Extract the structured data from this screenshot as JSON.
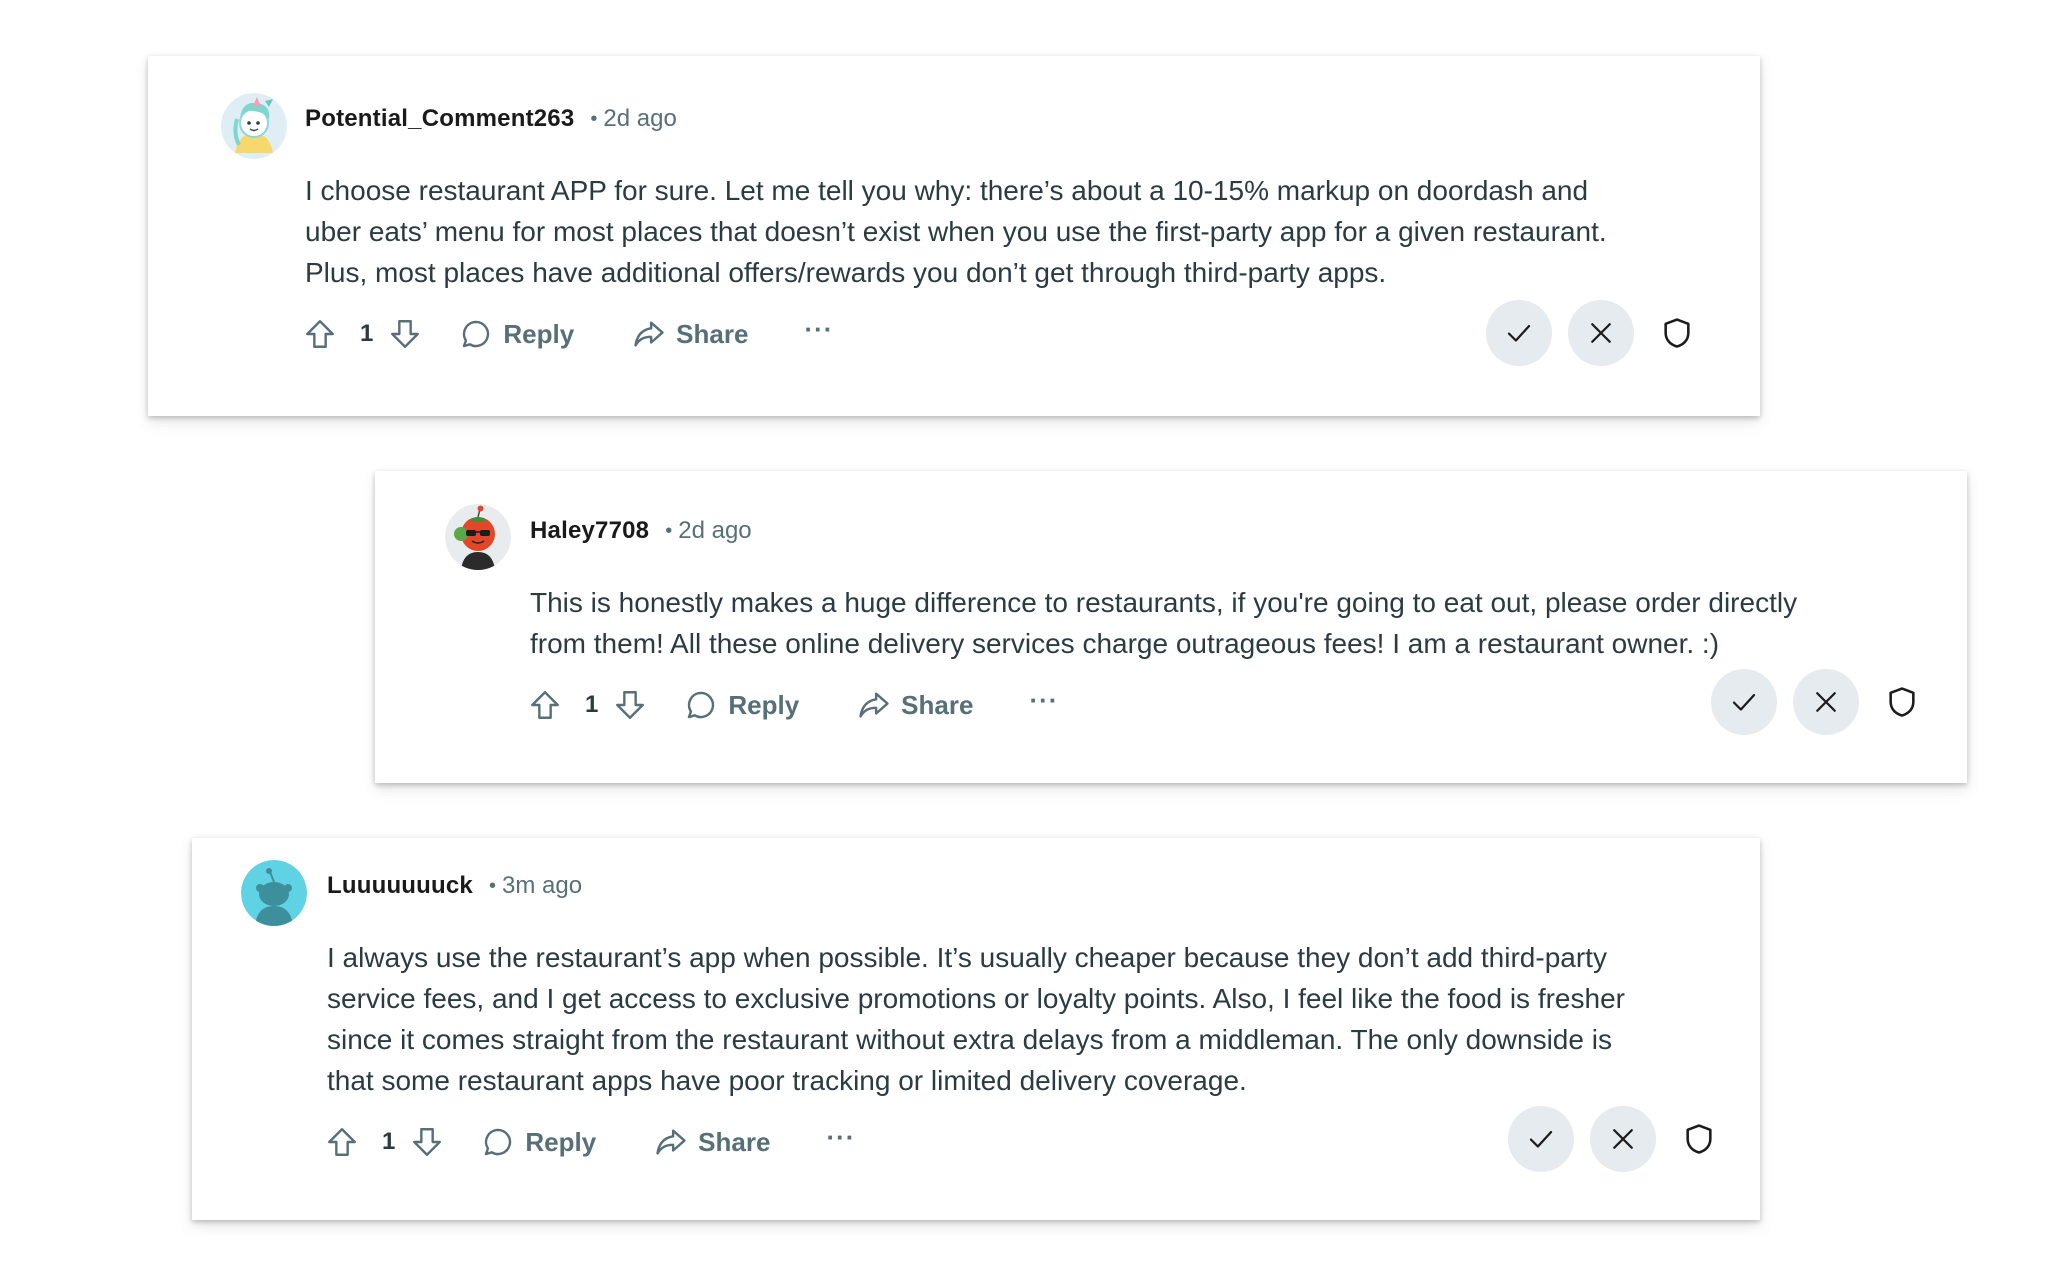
{
  "comments": [
    {
      "username": "Potential_Comment263",
      "separator": "•",
      "time": "2d ago",
      "avatar": "avatar-unicorn-icon",
      "lines": [
        "I choose restaurant APP for sure. Let me tell you why: there’s about a 10-15% markup on doordash and",
        "uber eats’ menu for most places that doesn’t exist when you use the first-party app for a given restaurant.",
        "Plus, most places have additional offers/rewards you don’t get through third-party apps."
      ],
      "votes": "1",
      "reply_label": "Reply",
      "share_label": "Share",
      "more_label": "···"
    },
    {
      "username": "Haley7708",
      "separator": "•",
      "time": "2d ago",
      "avatar": "avatar-snoo-tomato-icon",
      "lines": [
        "This is honestly makes a huge difference to restaurants, if you're going to eat out, please order directly",
        "from them! All these online delivery services charge outrageous fees! I am a restaurant owner. :)"
      ],
      "votes": "1",
      "reply_label": "Reply",
      "share_label": "Share",
      "more_label": "···"
    },
    {
      "username": "Luuuuuuuck",
      "separator": "•",
      "time": "3m ago",
      "avatar": "avatar-default-snoo-icon",
      "lines": [
        "I always use the restaurant’s app when possible. It’s usually cheaper because they don’t add third-party",
        "service fees, and I get access to exclusive promotions or loyalty points. Also, I feel like the food is fresher",
        "since it comes straight from the restaurant without extra delays from a middleman. The only downside is",
        "that some restaurant apps have poor tracking or limited delivery coverage."
      ],
      "votes": "1",
      "reply_label": "Reply",
      "share_label": "Share",
      "more_label": "···"
    }
  ],
  "colors": {
    "meta_text": "#576f76",
    "body_text": "#2a3c42",
    "mod_button_bg": "#e5ebee",
    "default_avatar_bg": "#5fd3e4"
  }
}
